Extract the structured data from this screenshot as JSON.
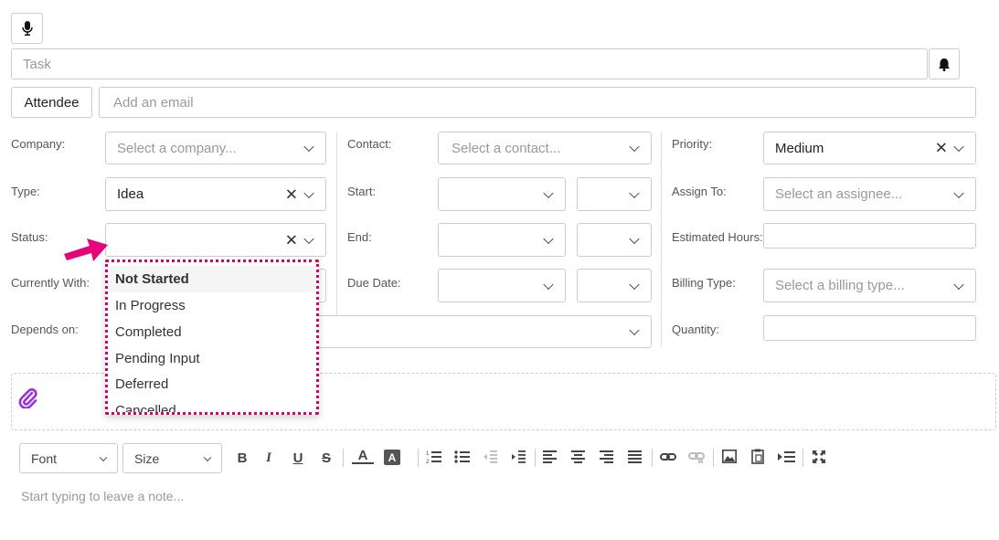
{
  "header": {
    "mic_icon": "microphone-icon",
    "task_placeholder": "Task",
    "bell_icon": "bell-icon",
    "attendee_label": "Attendee",
    "email_placeholder": "Add an email"
  },
  "fields": {
    "company_label": "Company:",
    "company_placeholder": "Select a company...",
    "contact_label": "Contact:",
    "contact_placeholder": "Select a contact...",
    "priority_label": "Priority:",
    "priority_value": "Medium",
    "type_label": "Type:",
    "type_value": "Idea",
    "start_label": "Start:",
    "assign_label": "Assign To:",
    "assign_placeholder": "Select an assignee...",
    "status_label": "Status:",
    "status_value": "",
    "end_label": "End:",
    "estimated_label": "Estimated Hours:",
    "currently_label": "Currently With:",
    "due_label": "Due Date:",
    "billing_label": "Billing Type:",
    "billing_placeholder": "Select a billing type...",
    "depends_label": "Depends on:",
    "quantity_label": "Quantity:",
    "clear_glyph": "✕"
  },
  "status_dropdown": {
    "options": [
      "Not Started",
      "In Progress",
      "Completed",
      "Pending Input",
      "Deferred",
      "Cancelled"
    ],
    "selected_index": 0
  },
  "attachment": {
    "icon": "paperclip-icon"
  },
  "editor": {
    "font_label": "Font",
    "size_label": "Size",
    "buttons": [
      "bold-icon",
      "italic-icon",
      "underline-icon",
      "strikethrough-icon",
      "font-color-icon",
      "highlight-color-icon",
      "ordered-list-icon",
      "unordered-list-icon",
      "outdent-icon",
      "indent-icon",
      "align-left-icon",
      "align-center-icon",
      "align-right-icon",
      "justify-icon",
      "link-icon",
      "unlink-icon",
      "image-icon",
      "paste-icon",
      "insert-table-icon",
      "fullscreen-icon"
    ],
    "glyphs": {
      "bold": "B",
      "italic": "I",
      "underline": "U",
      "strike": "S",
      "fontcolor": "A",
      "highlight": "A"
    },
    "placeholder": "Start typing to leave a note..."
  },
  "colors": {
    "accent_arrow": "#e8007a",
    "dropdown_border": "#d0006f",
    "attach_icon": "#9b30d9"
  }
}
